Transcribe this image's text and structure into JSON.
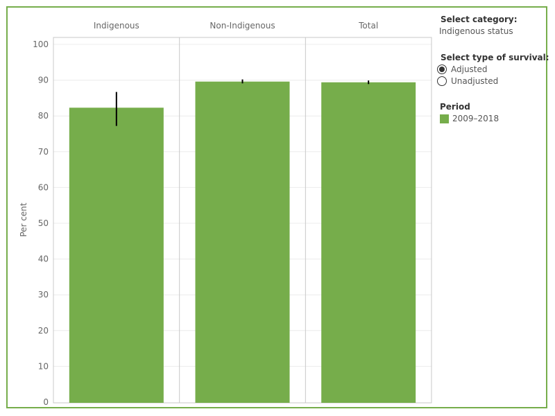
{
  "colors": {
    "bar": "#76ad4b",
    "frame": "#76ad4b",
    "grid": "#ececec",
    "axis": "#c8c8c8",
    "error": "#000000",
    "text": "#666666"
  },
  "controls": {
    "category_title": "Select category:",
    "category_value": "Indigenous status",
    "survival_title": "Select type of survival:",
    "survival_options": [
      {
        "label": "Adjusted",
        "selected": true
      },
      {
        "label": "Unadjusted",
        "selected": false
      }
    ],
    "period_title": "Period",
    "period_items": [
      {
        "label": "2009–2018",
        "color": "#76ad4b"
      }
    ]
  },
  "chart_data": {
    "type": "bar",
    "categories": [
      "Indigenous",
      "Non-Indigenous",
      "Total"
    ],
    "series": [
      {
        "name": "2009–2018",
        "values": [
          82.3,
          89.6,
          89.4
        ],
        "error_low": [
          77.2,
          89.1,
          88.9
        ],
        "error_high": [
          86.7,
          90.2,
          89.9
        ]
      }
    ],
    "ylabel": "Per cent",
    "xlabel": "",
    "ylim": [
      0,
      100
    ],
    "yticks": [
      0,
      10,
      20,
      30,
      40,
      50,
      60,
      70,
      80,
      90,
      100
    ],
    "grid": true,
    "legend": "right"
  }
}
